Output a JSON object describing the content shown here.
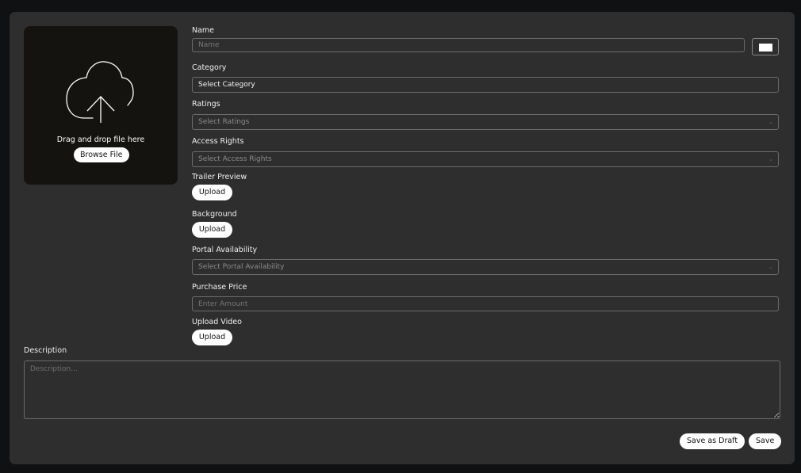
{
  "dropzone": {
    "icon": "cloud-upload-icon",
    "text": "Drag and drop file here",
    "browse_label": "Browse File"
  },
  "form": {
    "name": {
      "label": "Name",
      "placeholder": "Name"
    },
    "color_swatch": {
      "value": "#ffffff"
    },
    "category": {
      "label": "Category",
      "value": "Select Category"
    },
    "ratings": {
      "label": "Ratings",
      "placeholder": "Select Ratings"
    },
    "access_rights": {
      "label": "Access Rights",
      "placeholder": "Select Access Rights"
    },
    "trailer_preview": {
      "label": "Trailer Preview",
      "button": "Upload"
    },
    "background": {
      "label": "Background",
      "button": "Upload"
    },
    "portal_availability": {
      "label": "Portal Availability",
      "placeholder": "Select Portal Availability"
    },
    "purchase_price": {
      "label": "Purchase Price",
      "placeholder": "Enter Amount"
    },
    "upload_video": {
      "label": "Upload Video",
      "button": "Upload"
    },
    "description": {
      "label": "Description",
      "placeholder": "Description..."
    }
  },
  "actions": {
    "save_draft_label": "Save as Draft",
    "save_label": "Save"
  },
  "colors": {
    "page_bg": "#101112",
    "panel_bg": "#2e2e2e",
    "dropzone_bg": "#15130f",
    "button_bg": "#ffffff",
    "border": "#6b6b6b"
  }
}
